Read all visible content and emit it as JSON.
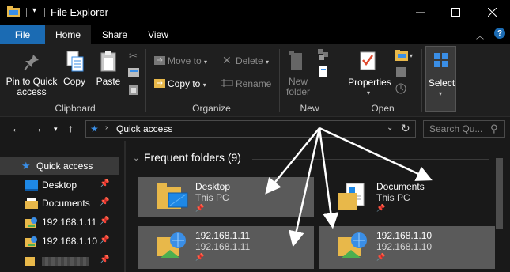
{
  "window": {
    "title": "File Explorer"
  },
  "tabs": {
    "file": "File",
    "home": "Home",
    "share": "Share",
    "view": "View"
  },
  "ribbon": {
    "clipboard": {
      "pin": "Pin to Quick\naccess",
      "copy": "Copy",
      "paste": "Paste",
      "label": "Clipboard"
    },
    "organize": {
      "move_to": "Move to",
      "copy_to": "Copy to",
      "delete": "Delete",
      "rename": "Rename",
      "label": "Organize"
    },
    "new": {
      "new_folder": "New\nfolder",
      "label": "New"
    },
    "open": {
      "properties": "Properties",
      "label": "Open"
    },
    "select": {
      "label": "Select"
    }
  },
  "address": {
    "path": "Quick access",
    "search_placeholder": "Search Qu..."
  },
  "navpane": {
    "items": [
      {
        "label": "Quick access"
      },
      {
        "label": "Desktop"
      },
      {
        "label": "Documents"
      },
      {
        "label": "192.168.1.11"
      },
      {
        "label": "192.168.1.10"
      }
    ]
  },
  "content": {
    "section_title": "Frequent folders (9)",
    "tiles": [
      {
        "name": "Desktop",
        "sub": "This PC"
      },
      {
        "name": "Documents",
        "sub": "This PC"
      },
      {
        "name": "192.168.1.11",
        "sub": "192.168.1.11"
      },
      {
        "name": "192.168.1.10",
        "sub": "192.168.1.10"
      }
    ]
  },
  "colors": {
    "accent": "#1b6bb3",
    "background": "#191919",
    "tile_highlight": "#5a5a5a",
    "ribbon": "#1f1f1f"
  }
}
